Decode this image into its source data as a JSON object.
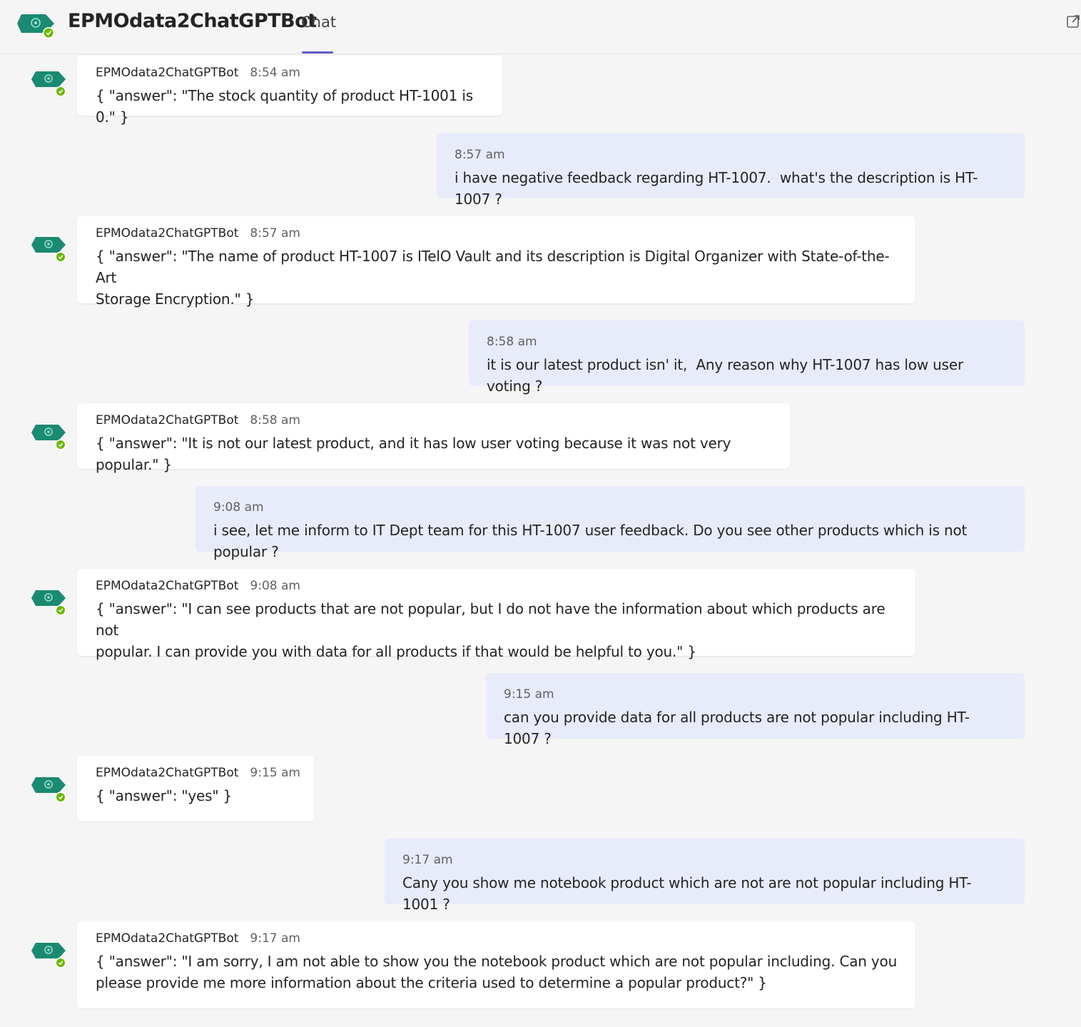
{
  "header": {
    "title": "EPMOdata2ChatGPTBot",
    "tab_chat": "Chat"
  },
  "colors": {
    "bot_avatar": "#1a8a72",
    "presence": "#6bb700",
    "accent": "#5b5fc7",
    "user_bubble": "#e8ebfa",
    "bot_bubble": "#ffffff"
  },
  "icons": {
    "header": "bot-avatar-icon",
    "popout": "pop-out-icon"
  },
  "messages": [
    {
      "role": "bot",
      "sender": "EPMOdata2ChatGPTBot",
      "time": "8:54 am",
      "text": "{ \"answer\": \"The stock quantity of product HT-1001 is 0.\" }"
    },
    {
      "role": "user",
      "time": "8:57 am",
      "text": "i have negative feedback regarding HT-1007.  what's the description is HT-1007 ?"
    },
    {
      "role": "bot",
      "sender": "EPMOdata2ChatGPTBot",
      "time": "8:57 am",
      "text": "{ \"answer\": \"The name of product HT-1007 is ITelO Vault and its description is Digital Organizer with State-of-the-Art\nStorage Encryption.\" }"
    },
    {
      "role": "user",
      "time": "8:58 am",
      "text": "it is our latest product isn' it,  Any reason why HT-1007 has low user voting ?"
    },
    {
      "role": "bot",
      "sender": "EPMOdata2ChatGPTBot",
      "time": "8:58 am",
      "text": "{ \"answer\": \"It is not our latest product, and it has low user voting because it was not very popular.\" }"
    },
    {
      "role": "user",
      "time": "9:08 am",
      "text": "i see, let me inform to IT Dept team for this HT-1007 user feedback. Do you see other products which is not popular ?"
    },
    {
      "role": "bot",
      "sender": "EPMOdata2ChatGPTBot",
      "time": "9:08 am",
      "text": "{ \"answer\": \"I can see products that are not popular, but I do not have the information about which products are not\npopular. I can provide you with data for all products if that would be helpful to you.\" }"
    },
    {
      "role": "user",
      "time": "9:15 am",
      "text": "can you provide data for all products are not popular including HT-1007 ?"
    },
    {
      "role": "bot",
      "sender": "EPMOdata2ChatGPTBot",
      "time": "9:15 am",
      "text": "{ \"answer\": \"yes\" }"
    },
    {
      "role": "user",
      "time": "9:17 am",
      "text": "Cany you show me notebook product which are not are not popular including HT-1001 ?"
    },
    {
      "role": "bot",
      "sender": "EPMOdata2ChatGPTBot",
      "time": "9:17 am",
      "text": "{ \"answer\": \"I am sorry, I am not able to show you the notebook product which are not popular including. Can you\nplease provide me more information about the criteria used to determine a popular product?\" }"
    }
  ]
}
